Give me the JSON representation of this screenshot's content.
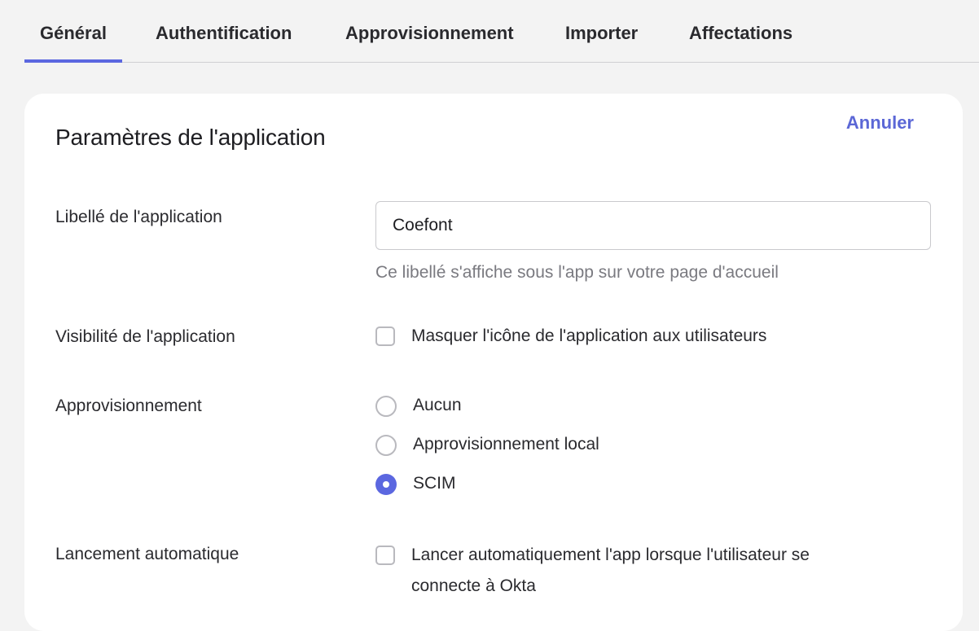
{
  "tabs": [
    {
      "label": "Général",
      "active": true
    },
    {
      "label": "Authentification",
      "active": false
    },
    {
      "label": "Approvisionnement",
      "active": false
    },
    {
      "label": "Importer",
      "active": false
    },
    {
      "label": "Affectations",
      "active": false
    }
  ],
  "card": {
    "title": "Paramètres de l'application",
    "cancel_label": "Annuler"
  },
  "fields": {
    "app_label": {
      "label": "Libellé de l'application",
      "value": "Coefont",
      "help": "Ce libellé s'affiche sous l'app sur votre page d'accueil"
    },
    "visibility": {
      "label": "Visibilité de l'application",
      "option": "Masquer l'icône de l'application aux utilisateurs",
      "checked": false
    },
    "provisioning": {
      "label": "Approvisionnement",
      "options": [
        {
          "label": "Aucun",
          "selected": false
        },
        {
          "label": "Approvisionnement local",
          "selected": false
        },
        {
          "label": "SCIM",
          "selected": true
        }
      ]
    },
    "auto_launch": {
      "label": "Lancement automatique",
      "option_line1": "Lancer automatiquement l'app lorsque l'utilisateur se",
      "option_line2": "connecte à Okta",
      "checked": false
    }
  },
  "colors": {
    "accent": "#5b67e0",
    "background": "#f3f3f3",
    "card": "#ffffff"
  }
}
